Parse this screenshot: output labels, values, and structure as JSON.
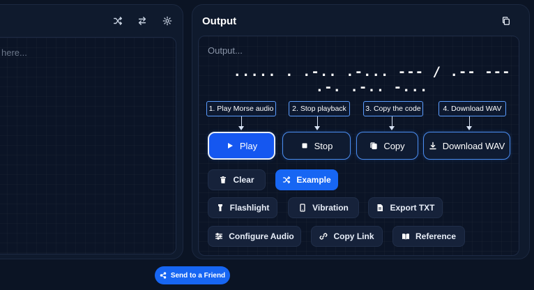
{
  "input": {
    "placeholder_fragment": "here..."
  },
  "output": {
    "title": "Output",
    "placeholder": "Output...",
    "morse": "..... . .-.. .-... --- / .-- --- .-. .-.. -..."
  },
  "callouts": [
    "1.  Play Morse audio",
    "2.  Stop playback",
    "3. Copy the code",
    "4.  Download WAV"
  ],
  "main_buttons": {
    "play": "Play",
    "stop": "Stop",
    "copy": "Copy",
    "download": "Download WAV"
  },
  "secondary_buttons": {
    "clear": "Clear",
    "example": "Example",
    "flashlight": "Flashlight",
    "vibration": "Vibration",
    "export": "Export TXT",
    "configure": "Configure Audio",
    "copy_link": "Copy Link",
    "reference": "Reference"
  },
  "footer": {
    "send": "Send to a Friend"
  },
  "colors": {
    "accent": "#1766f3",
    "panel": "#0f1a2d",
    "background": "#0b1424"
  },
  "icons": [
    "shuffle-icon",
    "swap-icon",
    "gear-icon",
    "copy-icon",
    "play-icon",
    "stop-icon",
    "download-icon",
    "trash-icon",
    "flashlight-icon",
    "phone-icon",
    "file-icon",
    "sliders-icon",
    "link-icon",
    "book-icon",
    "share-icon"
  ]
}
